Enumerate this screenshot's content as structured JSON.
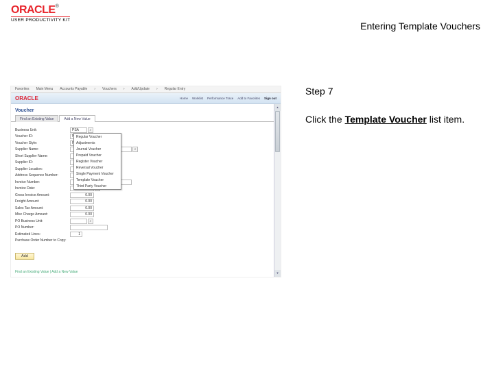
{
  "header": {
    "logo": "ORACLE",
    "logo_sub": "USER PRODUCTIVITY KIT",
    "title": "Entering Template Vouchers"
  },
  "step": {
    "label": "Step 7",
    "text_pre": "Click the ",
    "text_bold": "Template Voucher",
    "text_post": " list item."
  },
  "screenshot": {
    "menubar": [
      "Favorites",
      "Main Menu",
      "Accounts Payable",
      "Vouchers",
      "Add/Update",
      "Regular Entry"
    ],
    "brand": "ORACLE",
    "toplinks": [
      "Home",
      "Worklist",
      "Performance Trace",
      "Add to Favorites",
      "Sign out"
    ],
    "page_title": "Voucher",
    "tabs": [
      "Find an Existing Value",
      "Add a New Value"
    ],
    "form": {
      "bu_l": "Business Unit:",
      "bu_v": "PSA",
      "vid_l": "Voucher ID:",
      "vid_v": "NEXT",
      "vstyle_l": "Voucher Style:",
      "vstyle_v": "Regular Voucher",
      "sname_l": "Supplier Name:",
      "ssname_l": "Short Supplier Name:",
      "sid_l": "Supplier ID:",
      "sloc_l": "Supplier Location:",
      "aseq_l": "Address Sequence Number:",
      "inv_l": "Invoice Number:",
      "idate_l": "Invoice Date:",
      "gross_l": "Gross Invoice Amount:",
      "gross_v": "0.00",
      "freight_l": "Freight Amount:",
      "freight_v": "0.00",
      "sales_l": "Sales Tax Amount:",
      "sales_v": "0.00",
      "misc_l": "Misc Charge Amount:",
      "misc_v": "0.00",
      "pobu_l": "PO Business Unit:",
      "ponum_l": "PO Number:",
      "elines_l": "Estimated Lines:",
      "elines_v": "1",
      "poh_l": "Purchase Order Number to Copy:"
    },
    "dropdown": {
      "options": [
        "Regular Voucher",
        "Adjustments",
        "Journal Voucher",
        "Prepaid Voucher",
        "Register Voucher",
        "Reversal Voucher",
        "Single Payment Voucher",
        "Template Voucher",
        "Third Party Voucher"
      ]
    },
    "add_btn": "Add",
    "footer": "Find an Existing Value | Add a New Value"
  }
}
